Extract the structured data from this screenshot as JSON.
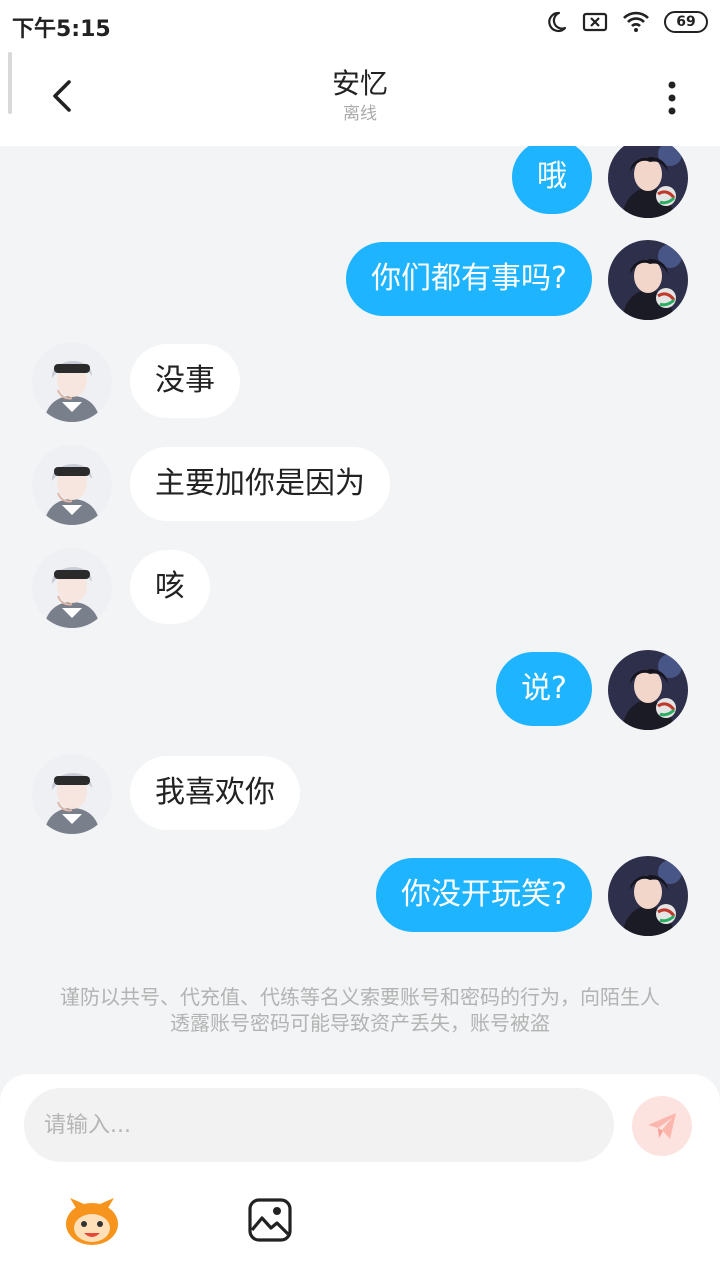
{
  "status_bar": {
    "time": "下午5:15",
    "battery": "69",
    "icons": [
      "moon-icon",
      "sim-off-icon",
      "wifi-icon",
      "battery-icon"
    ]
  },
  "header": {
    "title": "安忆",
    "status": "离线",
    "icons": [
      "back-arrow-icon",
      "more-vertical-icon"
    ]
  },
  "messages": [
    {
      "side": "right",
      "text": "哦"
    },
    {
      "side": "right",
      "text": "你们都有事吗?"
    },
    {
      "side": "left",
      "text": "没事"
    },
    {
      "side": "left",
      "text": "主要加你是因为"
    },
    {
      "side": "left",
      "text": "咳"
    },
    {
      "side": "right",
      "text": "说?"
    },
    {
      "side": "left",
      "text": "我喜欢你"
    },
    {
      "side": "right",
      "text": "你没开玩笑?"
    }
  ],
  "warning": "谨防以共号、代充值、代练等名义索要账号和密码的行为，向陌生人透露账号密码可能导致资产丢失，账号被盗",
  "composer": {
    "placeholder": "请输入...",
    "icons": [
      "send-icon",
      "emoji-icon",
      "image-icon"
    ]
  },
  "colors": {
    "outgoing_bubble": "#1eb4ff",
    "incoming_bubble": "#ffffff",
    "background": "#f2f4f6",
    "send_button": "#fde3e0",
    "emoji_orange": "#f7941d"
  }
}
